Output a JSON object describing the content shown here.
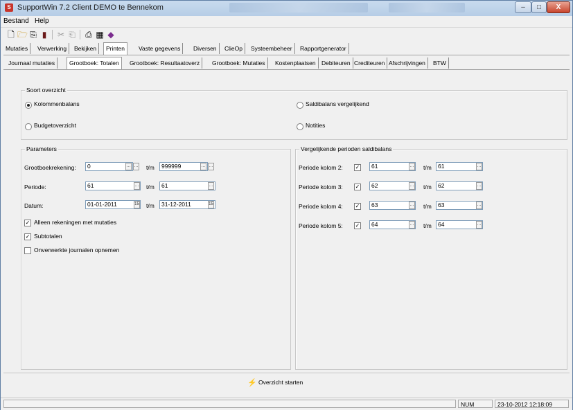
{
  "window": {
    "title": "SupportWin 7.2  Client DEMO te Bennekom",
    "app_icon": "S",
    "min_glyph": "–",
    "max_glyph": "□",
    "close_glyph": "X"
  },
  "menu": {
    "items": [
      "Bestand",
      "Help"
    ]
  },
  "toolbar": {
    "icons": [
      {
        "name": "new-doc-icon",
        "glyph": "🗋",
        "enabled": true
      },
      {
        "name": "open-folder-icon",
        "glyph": "🗁",
        "enabled": true
      },
      {
        "name": "copy-icon",
        "glyph": "⎘",
        "enabled": true
      },
      {
        "name": "book-icon",
        "glyph": "▮",
        "enabled": true
      },
      {
        "name": "cut-icon",
        "glyph": "✂",
        "enabled": false
      },
      {
        "name": "paste-icon",
        "glyph": "⎗",
        "enabled": false
      },
      {
        "name": "printer-icon",
        "glyph": "⎙",
        "enabled": true
      },
      {
        "name": "calculator-icon",
        "glyph": "▦",
        "enabled": true
      },
      {
        "name": "eraser-icon",
        "glyph": "◆",
        "enabled": true
      }
    ]
  },
  "main_tabs": [
    "Mutaties",
    "Verwerking",
    "Bekijken",
    "Printen",
    "Vaste gegevens",
    "Diversen",
    "ClieOp",
    "Systeembeheer",
    "Rapportgenerator"
  ],
  "main_tab_active": "Printen",
  "sub_tabs": [
    "Journaal mutaties",
    "Grootboek: Totalen",
    "Grootboek: Resultaatoverz",
    "Grootboek: Mutaties",
    "Kostenplaatsen",
    "Debiteuren",
    "Crediteuren",
    "Afschrijvingen",
    "BTW"
  ],
  "sub_tab_active": "Grootboek: Totalen",
  "overview": {
    "title": "Soort overzicht",
    "options": [
      "Kolommenbalans",
      "Saldibalans vergelijkend",
      "Budgetoverzicht",
      "Notities"
    ],
    "selected": "Kolommenbalans"
  },
  "parameters": {
    "title": "Parameters",
    "grootboek_label": "Grootboekrekening:",
    "grootboek_from": "0",
    "grootboek_to": "999999",
    "periode_label": "Periode:",
    "periode_from": "61",
    "periode_to": "61",
    "datum_label": "Datum:",
    "datum_from": "01-01-2011",
    "datum_to": "31-12-2011",
    "tm": "t/m",
    "calendar_glyph": "15",
    "ellipsis_glyph": "…",
    "checked_glyph": "✓",
    "checks": [
      {
        "label": "Alleen rekeningen met mutaties",
        "checked": true
      },
      {
        "label": "Subtotalen",
        "checked": true
      },
      {
        "label": "Onverwerkte journalen opnemen",
        "checked": false
      }
    ]
  },
  "compare": {
    "title": "Vergelijkende perioden saldibalans",
    "rows": [
      {
        "label": "Periode kolom 2:",
        "checked": true,
        "from": "61",
        "to": "61"
      },
      {
        "label": "Periode kolom 3:",
        "checked": true,
        "from": "62",
        "to": "62"
      },
      {
        "label": "Periode kolom 4:",
        "checked": true,
        "from": "63",
        "to": "63"
      },
      {
        "label": "Periode kolom 5:",
        "checked": true,
        "from": "64",
        "to": "64"
      }
    ]
  },
  "action": {
    "glyph": "⚡",
    "label": "Overzicht starten"
  },
  "status": {
    "num": "NUM",
    "datetime": "23-10-2012 12:18:09"
  }
}
